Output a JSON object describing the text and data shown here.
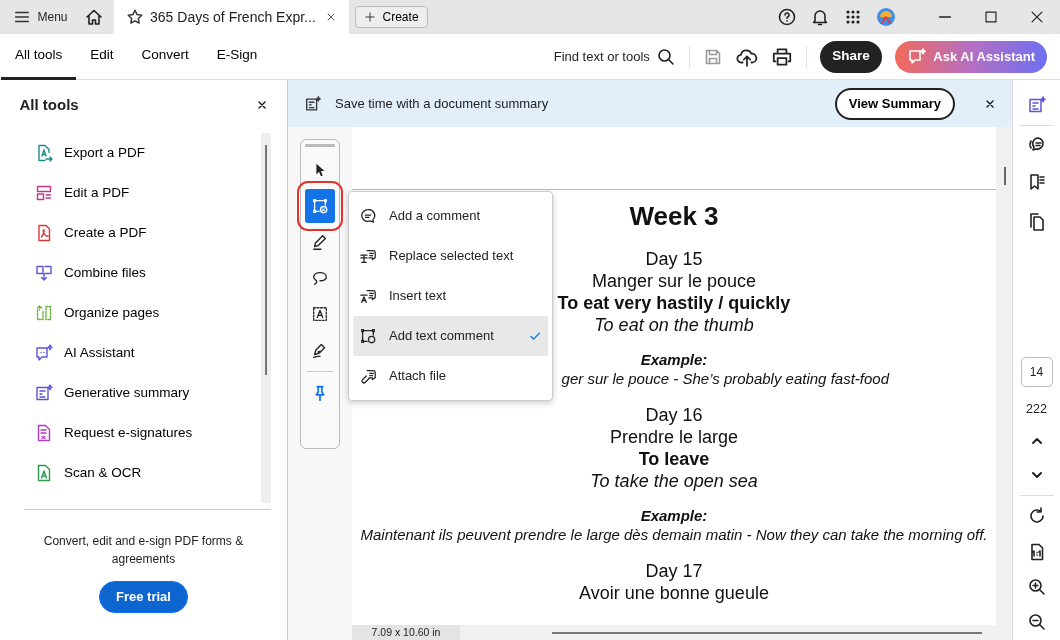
{
  "titlebar": {
    "menu_label": "Menu",
    "tab": {
      "title": "365 Days of French Expr...",
      "selected": true
    },
    "create_label": "Create"
  },
  "toolbar": {
    "tabs": [
      {
        "label": "All tools",
        "selected": true
      },
      {
        "label": "Edit",
        "selected": false
      },
      {
        "label": "Convert",
        "selected": false
      },
      {
        "label": "E-Sign",
        "selected": false
      }
    ],
    "search_label": "Find text or tools",
    "share_label": "Share",
    "assistant_label": "Ask AI Assistant"
  },
  "tools_panel": {
    "title": "All tools",
    "items": [
      {
        "label": "Export a PDF",
        "kind": "export"
      },
      {
        "label": "Edit a PDF",
        "kind": "edit"
      },
      {
        "label": "Create a PDF",
        "kind": "create"
      },
      {
        "label": "Combine files",
        "kind": "combine"
      },
      {
        "label": "Organize pages",
        "kind": "organize"
      },
      {
        "label": "AI Assistant",
        "kind": "assistant"
      },
      {
        "label": "Generative summary",
        "kind": "summary"
      },
      {
        "label": "Request e-signatures",
        "kind": "request"
      },
      {
        "label": "Scan & OCR",
        "kind": "scan"
      }
    ],
    "promo": "Convert, edit and e-sign PDF forms & agreements",
    "trial_label": "Free trial"
  },
  "banner": {
    "text": "Save time with a document summary",
    "button": "View Summary"
  },
  "quick_tools": [
    {
      "kind": "select",
      "selected": false
    },
    {
      "kind": "comment",
      "selected": true
    },
    {
      "kind": "draw",
      "selected": false
    },
    {
      "kind": "lasso",
      "selected": false
    },
    {
      "kind": "text",
      "selected": false
    },
    {
      "kind": "sign",
      "selected": false
    },
    {
      "kind": "pin",
      "selected": false
    }
  ],
  "comment_menu": [
    {
      "label": "Add a comment",
      "kind": "bubble",
      "checked": false
    },
    {
      "label": "Replace selected text",
      "kind": "replace",
      "checked": false
    },
    {
      "label": "Insert text",
      "kind": "insert",
      "checked": false
    },
    {
      "label": "Add text comment",
      "kind": "textbox",
      "checked": true
    },
    {
      "label": "Attach file",
      "kind": "attach",
      "checked": false
    }
  ],
  "document": {
    "lines": [
      {
        "text": "Week 3",
        "kind": "heading"
      },
      {
        "text": "Day 15",
        "kind": "day"
      },
      {
        "text": "Manger sur le pouce",
        "kind": "phrase"
      },
      {
        "text": "To eat very hastily / quickly",
        "kind": "meaning"
      },
      {
        "text": "To eat on the thumb",
        "kind": "literal"
      },
      {
        "text": "Example:",
        "kind": "example_label"
      },
      {
        "text": "ger sur le pouce - She’s probably eating fast-food",
        "kind": "example_covered"
      },
      {
        "text": "Day 16",
        "kind": "day"
      },
      {
        "text": "Prendre le large",
        "kind": "phrase"
      },
      {
        "text": "To leave",
        "kind": "meaning"
      },
      {
        "text": "To take the open sea",
        "kind": "literal"
      },
      {
        "text": "Example:",
        "kind": "example_label"
      },
      {
        "text": "Maintenant ils peuvent prendre le large dès demain matin - Now they can take the morning off.",
        "kind": "example"
      },
      {
        "text": "Day 17",
        "kind": "day"
      },
      {
        "text": "Avoir une bonne gueule",
        "kind": "phrase"
      }
    ],
    "page_size": "7.09 x 10.60 in"
  },
  "right_rail": {
    "page_number": "14",
    "page_count": "222"
  }
}
